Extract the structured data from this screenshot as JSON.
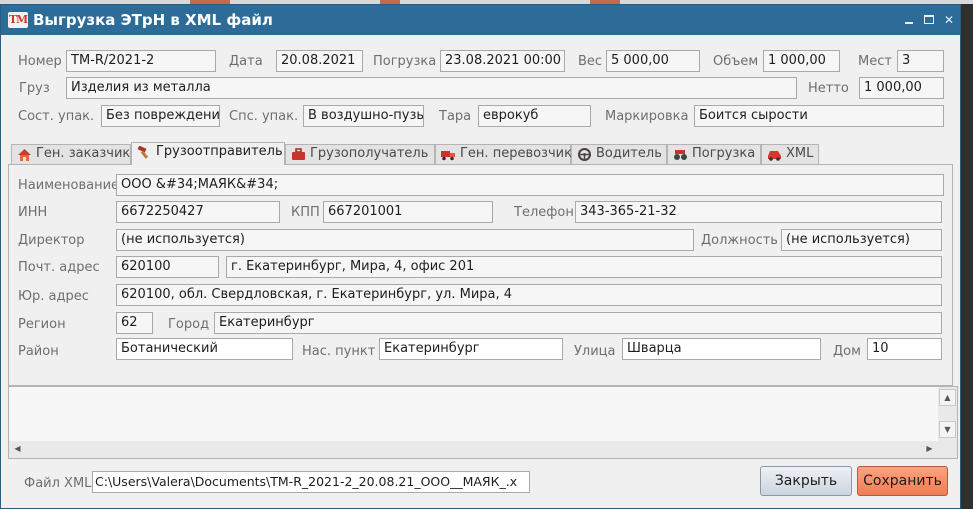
{
  "window": {
    "title": "Выгрузка ЭТрН в XML файл",
    "app_icon_text": "ТМ"
  },
  "header": {
    "nomer_label": "Номер",
    "nomer": "TM-R/2021-2",
    "data_label": "Дата",
    "data": "20.08.2021",
    "pogruzka_label": "Погрузка",
    "pogruzka": "23.08.2021 00:00",
    "ves_label": "Вес",
    "ves": "5 000,00",
    "obem_label": "Объем",
    "obem": "1 000,00",
    "mest_label": "Мест",
    "mest": "3",
    "gruz_label": "Груз",
    "gruz": "Изделия из металла",
    "netto_label": "Нетто",
    "netto": "1 000,00",
    "sost_label": "Сост. упак.",
    "sost": "Без повреждений",
    "sps_label": "Спс. упак.",
    "sps": "В воздушно-пузыр",
    "tara_label": "Тара",
    "tara": "еврокуб",
    "mark_label": "Маркировка",
    "mark": "Боится сырости"
  },
  "tabs": [
    {
      "label": "Ген. заказчик",
      "icon": "house-icon"
    },
    {
      "label": "Грузоотправитель",
      "icon": "hammer-icon",
      "active": true
    },
    {
      "label": "Грузополучатель",
      "icon": "suitcase-icon"
    },
    {
      "label": "Ген. перевозчик",
      "icon": "truck-icon"
    },
    {
      "label": "Водитель",
      "icon": "steering-wheel-icon"
    },
    {
      "label": "Погрузка",
      "icon": "loading-icon"
    },
    {
      "label": "XML",
      "icon": "car-icon"
    }
  ],
  "shipper": {
    "name_label": "Наименование",
    "name": "ООО &#34;МАЯК&#34;",
    "inn_label": "ИНН",
    "inn": "6672250427",
    "kpp_label": "КПП",
    "kpp": "667201001",
    "phone_label": "Телефон",
    "phone": "343-365-21-32",
    "director_label": "Директор",
    "director": "(не используется)",
    "position_label": "Должность",
    "position": "(не используется)",
    "post_label": "Почт. адрес",
    "post_index": "620100",
    "post_address": "г. Екатеринбург, Мира, 4, офис 201",
    "legal_label": "Юр. адрес",
    "legal_address": "620100, обл. Свердловская, г. Екатеринбург, ул. Мира, 4",
    "region_label": "Регион",
    "region": "62",
    "city_label": "Город",
    "city": "Екатеринбург",
    "district_label": "Район",
    "district": "Ботанический",
    "locality_label": "Нас. пункт",
    "locality": "Екатеринбург",
    "street_label": "Улица",
    "street": "Шварца",
    "house_label": "Дом",
    "house": "10"
  },
  "footer": {
    "file_label": "Файл XML",
    "file_path": "C:\\Users\\Valera\\Documents\\TM-R_2021-2_20.08.21_ООО__МАЯК_.x",
    "close_label": "Закрыть",
    "save_label": "Сохранить"
  },
  "colors": {
    "titlebar": "#2d6c99",
    "save_button": "#f38a63",
    "close_button": "#dde2ea"
  }
}
